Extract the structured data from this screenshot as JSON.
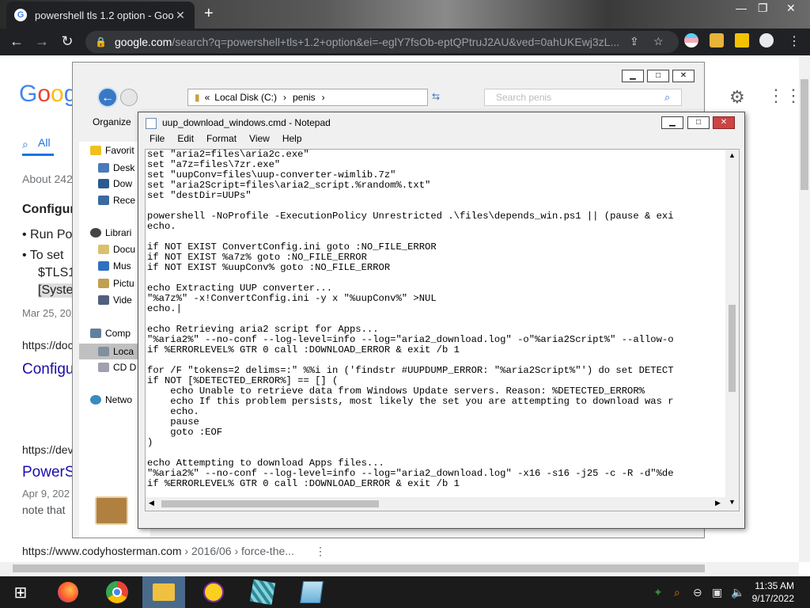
{
  "browser": {
    "tab_title": "powershell tls 1.2 option - Goog",
    "tab_close": "✕",
    "new_tab": "+",
    "url_host": "google.com",
    "url_path": "/search?q=powershell+tls+1.2+option&ei=-eglY7fsOb-eptQPtruJ2AU&ved=0ahUKEwj3zL..."
  },
  "google": {
    "tab_all": "All",
    "about": "About 242",
    "heading": "Configur",
    "bullet1": "Run Po",
    "bullet2": "To set",
    "bullet2b": "$TLS1",
    "bullet2c": "[Syste",
    "date1": "Mar 25, 202",
    "url1": "https://doc",
    "link1": "Configu",
    "url2": "https://dev",
    "link2": "PowerS",
    "date2": "Apr 9, 202",
    "note": "note that",
    "url3_host": "https://www.codyhosterman.com",
    "url3_path": " › 2016/06 › force-the...",
    "url3_more": "⋮"
  },
  "explorer": {
    "address_root": "Local Disk (C:)",
    "address_folder": "penis",
    "search_placeholder": "Search penis",
    "organize": "Organize",
    "nav": {
      "favorites": "Favorit",
      "desktop": "Desk",
      "downloads": "Dow",
      "recent": "Rece",
      "libraries": "Librari",
      "documents": "Docu",
      "music": "Mus",
      "pictures": "Pictu",
      "videos": "Vide",
      "computer": "Comp",
      "local": "Loca",
      "cd": "CD D",
      "network": "Netwo"
    }
  },
  "notepad": {
    "title": "uup_download_windows.cmd - Notepad",
    "menu": [
      "File",
      "Edit",
      "Format",
      "View",
      "Help"
    ],
    "lines": [
      "set \"aria2=files\\aria2c.exe\"",
      "set \"a7z=files\\7zr.exe\"",
      "set \"uupConv=files\\uup-converter-wimlib.7z\"",
      "set \"aria2Script=files\\aria2_script.%random%.txt\"",
      "set \"destDir=UUPs\"",
      "",
      "powershell -NoProfile -ExecutionPolicy Unrestricted .\\files\\depends_win.ps1 || (pause & exi",
      "echo.",
      "",
      "if NOT EXIST ConvertConfig.ini goto :NO_FILE_ERROR",
      "if NOT EXIST %a7z% goto :NO_FILE_ERROR",
      "if NOT EXIST %uupConv% goto :NO_FILE_ERROR",
      "",
      "echo Extracting UUP converter...",
      "\"%a7z%\" -x!ConvertConfig.ini -y x \"%uupConv%\" >NUL",
      "echo.|",
      "",
      "echo Retrieving aria2 script for Apps...",
      "\"%aria2%\" --no-conf --log-level=info --log=\"aria2_download.log\" -o\"%aria2Script%\" --allow-o",
      "if %ERRORLEVEL% GTR 0 call :DOWNLOAD_ERROR & exit /b 1",
      "",
      "for /F \"tokens=2 delims=:\" %%i in ('findstr #UUPDUMP_ERROR: \"%aria2Script%\"') do set DETECT",
      "if NOT [%DETECTED_ERROR%] == [] (",
      "    echo Unable to retrieve data from Windows Update servers. Reason: %DETECTED_ERROR%",
      "    echo If this problem persists, most likely the set you are attempting to download was r",
      "    echo.",
      "    pause",
      "    goto :EOF",
      ")",
      "",
      "echo Attempting to download Apps files...",
      "\"%aria2%\" --no-conf --log-level=info --log=\"aria2_download.log\" -x16 -s16 -j25 -c -R -d\"%de",
      "if %ERRORLEVEL% GTR 0 call :DOWNLOAD_ERROR & exit /b 1"
    ]
  },
  "taskbar": {
    "time": "11:35 AM",
    "date": "9/17/2022"
  }
}
